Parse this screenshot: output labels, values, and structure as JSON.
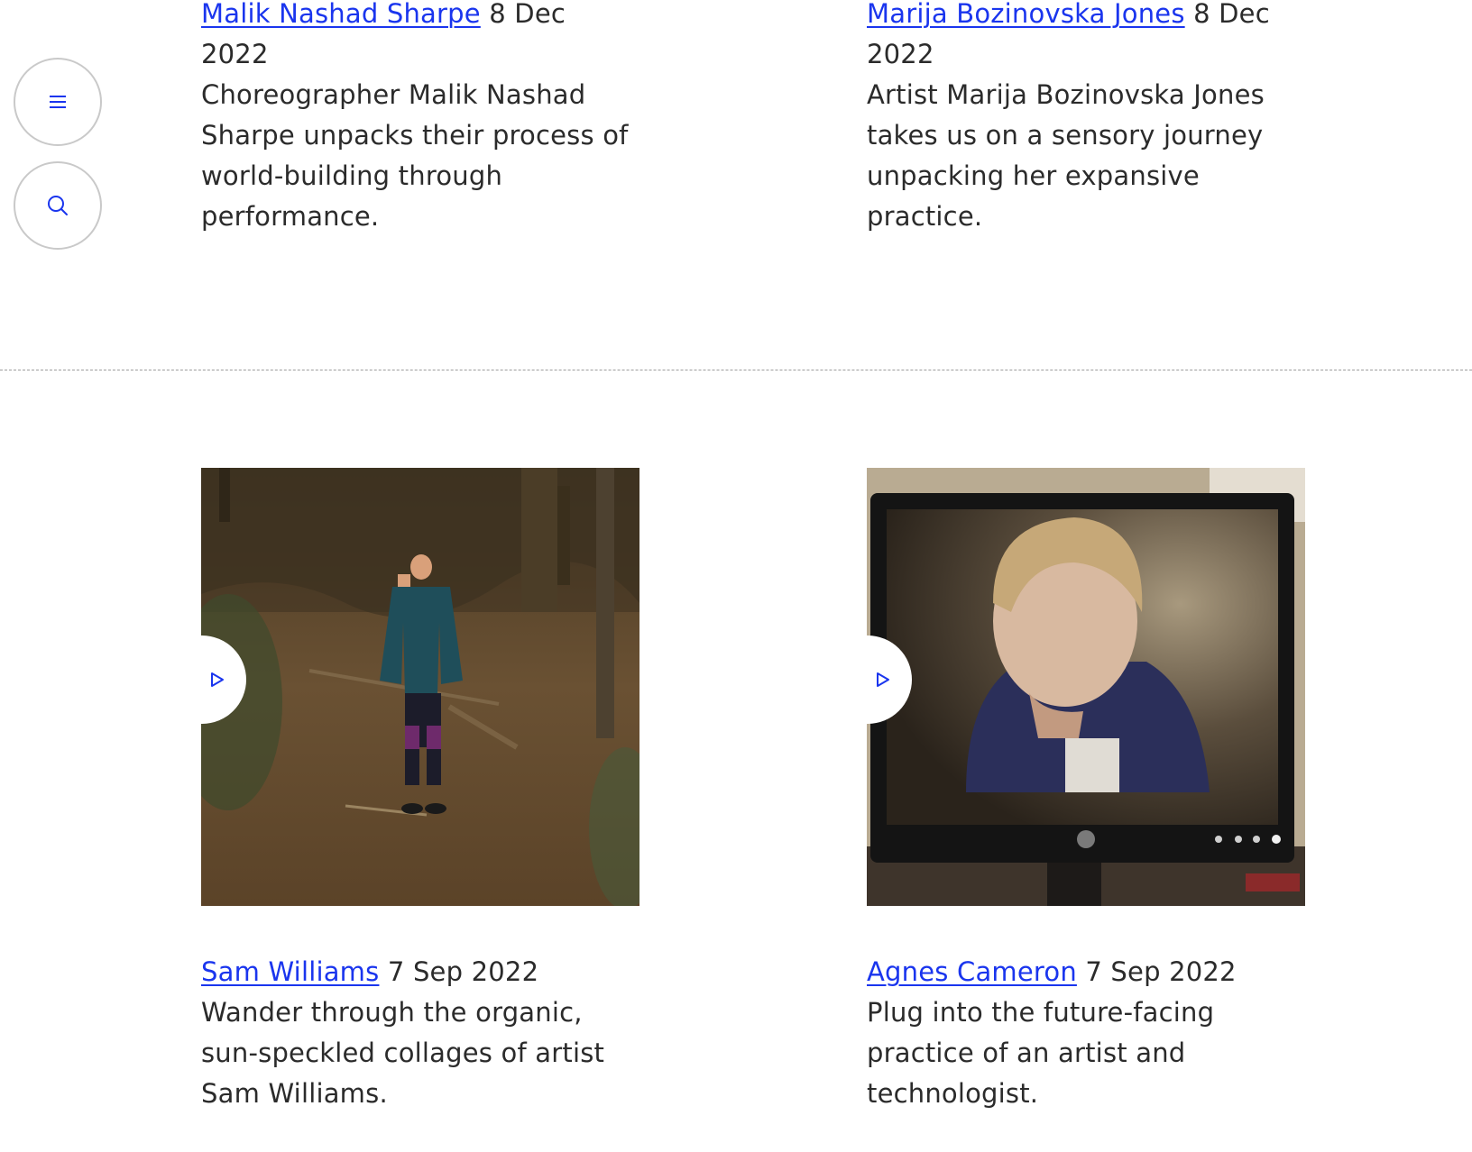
{
  "sidebar": {
    "menu_icon": "hamburger-menu-icon",
    "search_icon": "search-icon"
  },
  "accent_color": "#1a35ee",
  "articles_top": [
    {
      "author": "Malik Nashad Sharpe",
      "date": "8 Dec 2022",
      "description": "Choreographer Malik Nashad Sharpe unpacks their process of world-building through performance."
    },
    {
      "author": "Marija Bozinovska Jones",
      "date": "8 Dec 2022",
      "description": "Artist Marija Bozinovska Jones takes us on a sensory journey unpacking her expansive practice."
    }
  ],
  "articles_bottom": [
    {
      "author": "Sam Williams",
      "date": "7 Sep 2022",
      "description": "Wander through the organic, sun-speckled collages of artist Sam Williams.",
      "play_icon": "play-icon"
    },
    {
      "author": "Agnes Cameron",
      "date": "7 Sep 2022",
      "description": "Plug into the future-facing practice of an artist and technologist.",
      "play_icon": "play-icon"
    }
  ]
}
